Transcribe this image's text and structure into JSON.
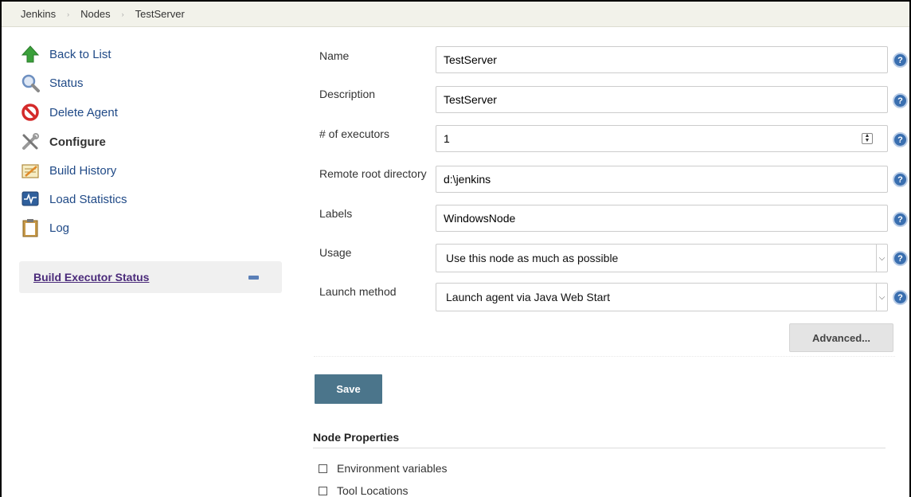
{
  "breadcrumb": {
    "items": [
      "Jenkins",
      "Nodes",
      "TestServer"
    ],
    "separator": "›"
  },
  "sidebar": {
    "items": [
      {
        "label": "Back to List",
        "icon": "up-arrow-icon"
      },
      {
        "label": "Status",
        "icon": "magnifier-icon"
      },
      {
        "label": "Delete Agent",
        "icon": "no-entry-icon"
      },
      {
        "label": "Configure",
        "icon": "tools-icon"
      },
      {
        "label": "Build History",
        "icon": "notepad-icon"
      },
      {
        "label": "Load Statistics",
        "icon": "monitor-graph-icon"
      },
      {
        "label": "Log",
        "icon": "clipboard-icon"
      }
    ],
    "executor_status": {
      "title": "Build Executor Status"
    }
  },
  "form": {
    "name": {
      "label": "Name",
      "value": "TestServer"
    },
    "description": {
      "label": "Description",
      "value": "TestServer"
    },
    "executors": {
      "label": "# of executors",
      "value": "1"
    },
    "remote_root": {
      "label": "Remote root directory",
      "value": "d:\\jenkins"
    },
    "labels": {
      "label": "Labels",
      "value": "WindowsNode"
    },
    "usage": {
      "label": "Usage",
      "value": "Use this node as much as possible"
    },
    "launch_method": {
      "label": "Launch method",
      "value": "Launch agent via Java Web Start"
    },
    "help_glyph": "?",
    "advanced_label": "Advanced...",
    "save_label": "Save"
  },
  "node_properties": {
    "title": "Node Properties",
    "items": [
      {
        "label": "Environment variables",
        "checked": false
      },
      {
        "label": "Tool Locations",
        "checked": false
      }
    ]
  },
  "colors": {
    "link": "#204a87",
    "save_button": "#4b758b",
    "help_icon": "#3a6fb0",
    "breadcrumb_bg": "#f2f2ea"
  }
}
